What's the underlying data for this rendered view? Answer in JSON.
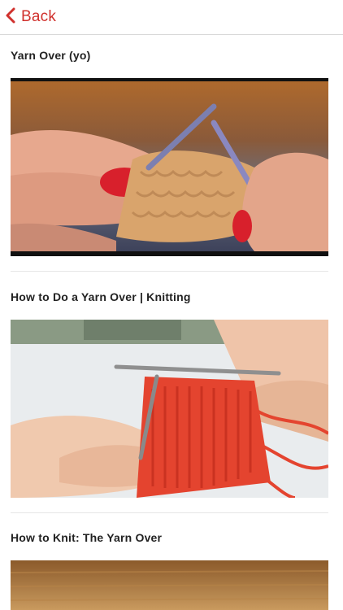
{
  "header": {
    "back_label": "Back",
    "accent_color": "#d0312d",
    "back_icon": "chevron-left-icon"
  },
  "feed": {
    "items": [
      {
        "title": "Yarn Over (yo)"
      },
      {
        "title": "How to Do a Yarn Over | Knitting"
      },
      {
        "title": "How to Knit: The Yarn Over"
      }
    ]
  }
}
